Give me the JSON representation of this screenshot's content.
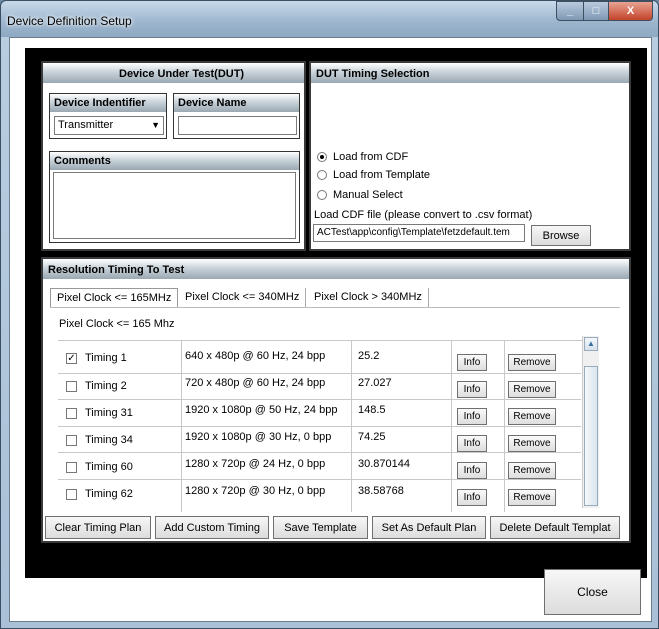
{
  "window": {
    "title": "Device Definition Setup",
    "min_glyph": "_",
    "max_glyph": "□",
    "close_glyph": "X"
  },
  "dut": {
    "title": "Device Under Test(DUT)",
    "identifier_label": "Device Indentifier",
    "identifier_value": "Transmitter",
    "name_label": "Device Name",
    "name_value": "",
    "comments_label": "Comments",
    "comments_value": ""
  },
  "timing_selection": {
    "title": "DUT Timing Selection",
    "options": [
      "Load from CDF",
      "Load from Template",
      "Manual Select"
    ],
    "selected": "Load from CDF",
    "cdf_label": "Load CDF file (please convert to .csv format)",
    "cdf_path": "ACTest\\app\\config\\Template\\fetzdefault.tem",
    "browse_label": "Browse"
  },
  "resolution": {
    "title": "Resolution Timing To Test",
    "tabs": [
      "Pixel Clock <= 165MHz",
      "Pixel Clock <= 340MHz",
      "Pixel Clock > 340MHz"
    ],
    "active_tab": "Pixel Clock <= 165MHz",
    "group_label": "Pixel Clock <= 165 Mhz",
    "rows": [
      {
        "checked": true,
        "name": "Timing 1",
        "format": "640 x 480p @ 60 Hz, 24 bpp",
        "clock": "25.2",
        "info": "Info",
        "remove": "Remove"
      },
      {
        "checked": false,
        "name": "Timing 2",
        "format": "720 x 480p @ 60 Hz, 24 bpp",
        "clock": "27.027",
        "info": "Info",
        "remove": "Remove"
      },
      {
        "checked": false,
        "name": "Timing 31",
        "format": "1920 x 1080p @ 50 Hz, 24 bpp",
        "clock": "148.5",
        "info": "Info",
        "remove": "Remove"
      },
      {
        "checked": false,
        "name": "Timing 34",
        "format": "1920 x 1080p @ 30 Hz, 0 bpp",
        "clock": "74.25",
        "info": "Info",
        "remove": "Remove"
      },
      {
        "checked": false,
        "name": "Timing 60",
        "format": "1280 x 720p @ 24 Hz, 0 bpp",
        "clock": "30.870144",
        "info": "Info",
        "remove": "Remove"
      },
      {
        "checked": false,
        "name": "Timing 62",
        "format": "1280 x 720p @ 30 Hz, 0 bpp",
        "clock": "38.58768",
        "info": "Info",
        "remove": "Remove"
      }
    ],
    "buttons": {
      "clear": "Clear Timing Plan",
      "add_custom": "Add Custom Timing",
      "save_template": "Save Template",
      "set_default": "Set As Default Plan",
      "delete_default": "Delete  Default Templat"
    }
  },
  "close_label": "Close"
}
